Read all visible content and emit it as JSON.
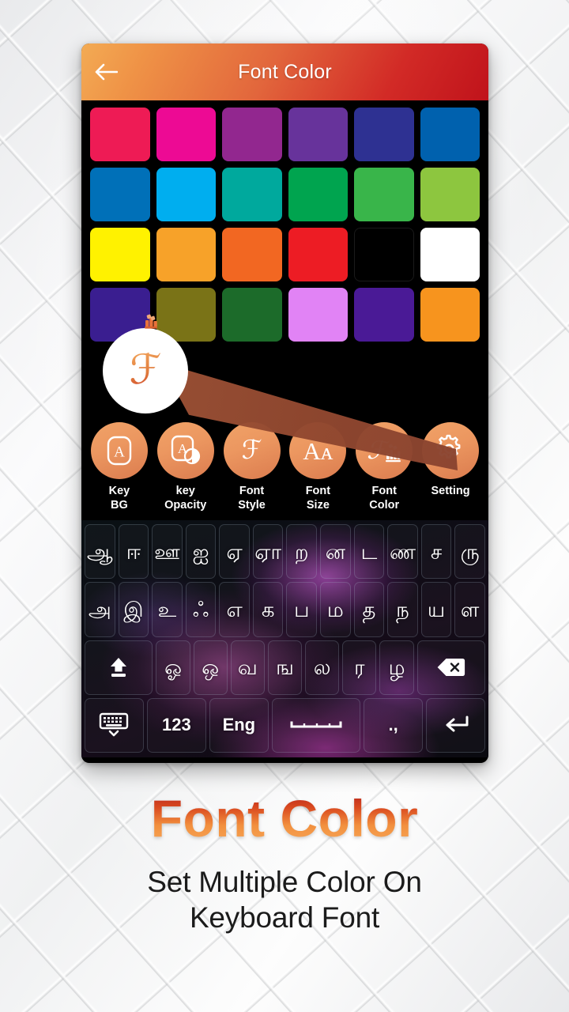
{
  "header": {
    "title": "Font Color",
    "back_icon": "arrow-left-icon"
  },
  "palette": {
    "rows": [
      [
        {
          "name": "swatch-crimson-pink",
          "hex": "#EE1B55"
        },
        {
          "name": "swatch-magenta",
          "hex": "#ED0A94"
        },
        {
          "name": "swatch-purple-orchid",
          "hex": "#92278F"
        },
        {
          "name": "swatch-violet",
          "hex": "#67339B"
        },
        {
          "name": "swatch-indigo",
          "hex": "#2E3192"
        },
        {
          "name": "swatch-sapphire-blue",
          "hex": "#0061AE"
        }
      ],
      [
        {
          "name": "swatch-ocean-blue",
          "hex": "#0070B8"
        },
        {
          "name": "swatch-sky-cyan",
          "hex": "#00AEEF"
        },
        {
          "name": "swatch-teal",
          "hex": "#00A99D"
        },
        {
          "name": "swatch-emerald-green",
          "hex": "#00A44F"
        },
        {
          "name": "swatch-grass-green",
          "hex": "#39B54A"
        },
        {
          "name": "swatch-lime-green",
          "hex": "#8DC63F"
        }
      ],
      [
        {
          "name": "swatch-yellow",
          "hex": "#FFF200"
        },
        {
          "name": "swatch-amber-orange",
          "hex": "#F7A229"
        },
        {
          "name": "swatch-tangerine",
          "hex": "#F26722"
        },
        {
          "name": "swatch-red",
          "hex": "#ED1C24"
        },
        {
          "name": "swatch-black",
          "hex": "#000000"
        },
        {
          "name": "swatch-white",
          "hex": "#FFFFFF"
        }
      ],
      [
        {
          "name": "swatch-deep-indigo",
          "hex": "#3A1E90"
        },
        {
          "name": "swatch-olive",
          "hex": "#7A7317"
        },
        {
          "name": "swatch-forest-green",
          "hex": "#1C6B2A"
        },
        {
          "name": "swatch-light-orchid",
          "hex": "#E183F5"
        },
        {
          "name": "swatch-royal-purple",
          "hex": "#4A1A96"
        },
        {
          "name": "swatch-orange",
          "hex": "#F7941E"
        }
      ]
    ]
  },
  "toolbar": {
    "items": [
      {
        "name": "tool-key-bg",
        "label": "Key\nBG",
        "icon": "letter-a-rounded-box-icon"
      },
      {
        "name": "tool-key-opacity",
        "label": "key\nOpacity",
        "icon": "letter-a-box-opacity-icon"
      },
      {
        "name": "tool-font-style",
        "label": "Font\nStyle",
        "icon": "script-f-icon",
        "glyph": "ℱ"
      },
      {
        "name": "tool-font-size",
        "label": "Font\nSize",
        "icon": "double-a-size-icon",
        "glyph": "Aᴀ"
      },
      {
        "name": "tool-font-color",
        "label": "Font\nColor",
        "icon": "script-f-palette-icon",
        "glyph": "ℱ"
      },
      {
        "name": "tool-setting",
        "label": "Setting",
        "icon": "gear-icon"
      }
    ]
  },
  "keyboard": {
    "rows": [
      {
        "name": "keyboard-row-1",
        "keys": [
          {
            "label": "ஆ"
          },
          {
            "label": "ஈ"
          },
          {
            "label": "ஊ"
          },
          {
            "label": "ஐ"
          },
          {
            "label": "ஏ"
          },
          {
            "label": "ஏா"
          },
          {
            "label": "ற"
          },
          {
            "label": "ன"
          },
          {
            "label": "ட"
          },
          {
            "label": "ண"
          },
          {
            "label": "ச"
          },
          {
            "label": "ரு"
          }
        ]
      },
      {
        "name": "keyboard-row-2",
        "keys": [
          {
            "label": "அ"
          },
          {
            "label": "இ"
          },
          {
            "label": "உ"
          },
          {
            "label": "ஃ"
          },
          {
            "label": "எ"
          },
          {
            "label": "க"
          },
          {
            "label": "ப"
          },
          {
            "label": "ம"
          },
          {
            "label": "த"
          },
          {
            "label": "ந"
          },
          {
            "label": "ய"
          },
          {
            "label": "ள"
          }
        ]
      },
      {
        "name": "keyboard-row-3",
        "keys": [
          {
            "label": "",
            "icon": "shift-icon",
            "wide": 2
          },
          {
            "label": "ஓ"
          },
          {
            "label": "ஒ"
          },
          {
            "label": "வ"
          },
          {
            "label": "ங"
          },
          {
            "label": "ல"
          },
          {
            "label": "ர"
          },
          {
            "label": "ழ"
          },
          {
            "label": "",
            "icon": "backspace-icon",
            "wide": 2
          }
        ]
      },
      {
        "name": "keyboard-row-4",
        "keys": [
          {
            "label": "",
            "icon": "hide-keyboard-icon",
            "wide": 2
          },
          {
            "label": "123",
            "small": true,
            "wide": 2
          },
          {
            "label": "Eng",
            "small": true,
            "wide": 2
          },
          {
            "label": "",
            "icon": "space-icon",
            "wide": 3
          },
          {
            "label": ".,",
            "small": true,
            "wide": 2
          },
          {
            "label": "",
            "icon": "enter-icon",
            "wide": 2
          }
        ]
      }
    ]
  },
  "pointer": {
    "name": "font-color-pointer",
    "bubble_glyph": "ℱ"
  },
  "promo": {
    "title": "Font Color",
    "subtitle": "Set Multiple Color On\nKeyboard Font"
  },
  "colors": {
    "header_gradient_start": "#F3AB54",
    "header_gradient_end": "#C0131B",
    "tool_circle_start": "#F0A267",
    "tool_circle_end": "#DB7C4F",
    "promo_title_start": "#B3211D",
    "promo_title_end": "#F7A85A"
  }
}
